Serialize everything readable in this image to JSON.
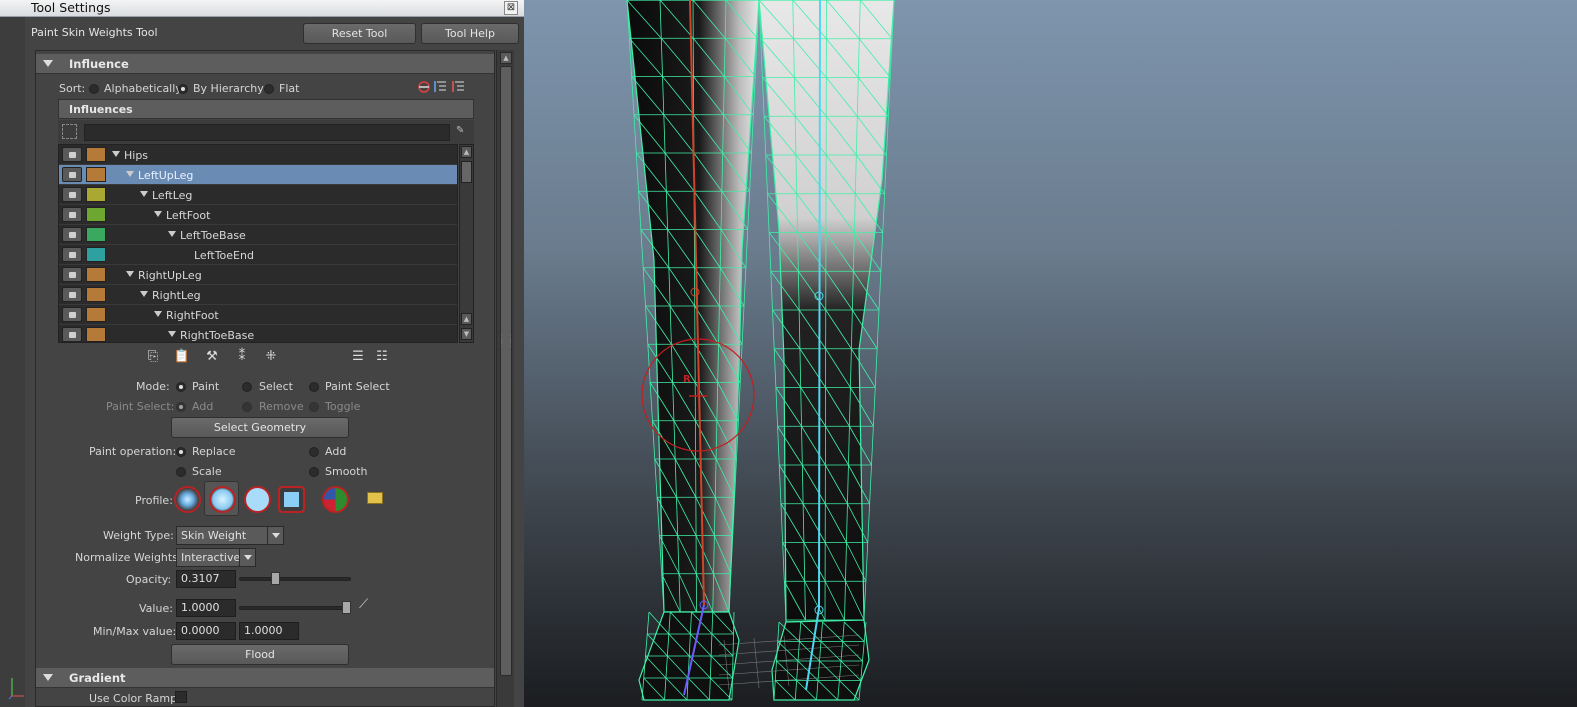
{
  "window": {
    "title": "Tool Settings",
    "close_glyph": "⊠"
  },
  "tool": {
    "name": "Paint Skin Weights Tool",
    "reset_label": "Reset Tool",
    "help_label": "Tool Help"
  },
  "influence_section": {
    "title": "Influence",
    "sort_label": "Sort:",
    "sort_options": [
      "Alphabetically",
      "By Hierarchy",
      "Flat"
    ],
    "sort_selected": "By Hierarchy",
    "influences_header": "Influences",
    "filter_value": "",
    "joints": [
      {
        "name": "Hips",
        "color": "#b67a38",
        "has_children": true,
        "selected": false
      },
      {
        "name": "LeftUpLeg",
        "color": "#b67a38",
        "has_children": true,
        "selected": true
      },
      {
        "name": "LeftLeg",
        "color": "#a8a832",
        "has_children": true,
        "selected": false
      },
      {
        "name": "LeftFoot",
        "color": "#6ea632",
        "has_children": true,
        "selected": false
      },
      {
        "name": "LeftToeBase",
        "color": "#3aa85e",
        "has_children": true,
        "selected": false
      },
      {
        "name": "LeftToeEnd",
        "color": "#2ea0a0",
        "has_children": false,
        "selected": false
      },
      {
        "name": "RightUpLeg",
        "color": "#b67a38",
        "has_children": true,
        "selected": false
      },
      {
        "name": "RightLeg",
        "color": "#b67a38",
        "has_children": true,
        "selected": false
      },
      {
        "name": "RightFoot",
        "color": "#b67a38",
        "has_children": true,
        "selected": false
      },
      {
        "name": "RightToeBase",
        "color": "#b67a38",
        "has_children": true,
        "selected": false
      }
    ]
  },
  "mode": {
    "label": "Mode:",
    "options": [
      "Paint",
      "Select",
      "Paint Select"
    ],
    "selected": "Paint",
    "paint_select_label": "Paint Select:",
    "paint_select_options": [
      "Add",
      "Remove",
      "Toggle"
    ],
    "select_geometry_label": "Select Geometry"
  },
  "paint_operation": {
    "label": "Paint operation:",
    "options": [
      "Replace",
      "Add",
      "Scale",
      "Smooth"
    ],
    "selected": "Replace"
  },
  "profile": {
    "label": "Profile:"
  },
  "weight_type": {
    "label": "Weight Type:",
    "value": "Skin Weight"
  },
  "normalize": {
    "label": "Normalize Weights:",
    "value": "Interactive"
  },
  "opacity": {
    "label": "Opacity:",
    "value": "0.3107",
    "slider": 0.3107
  },
  "value": {
    "label": "Value:",
    "value": "1.0000",
    "slider": 1.0
  },
  "minmax": {
    "label": "Min/Max value:",
    "min": "0.0000",
    "max": "1.0000"
  },
  "flood_label": "Flood",
  "gradient_section": {
    "title": "Gradient",
    "use_color_ramp_label": "Use Color Ramp"
  },
  "viewport": {
    "brush_label": "R",
    "colors": {
      "wire": "#3ff0a8",
      "joint_left": "#d0452a",
      "joint_right": "#4fd6f0",
      "brush": "#c41e1e"
    }
  }
}
